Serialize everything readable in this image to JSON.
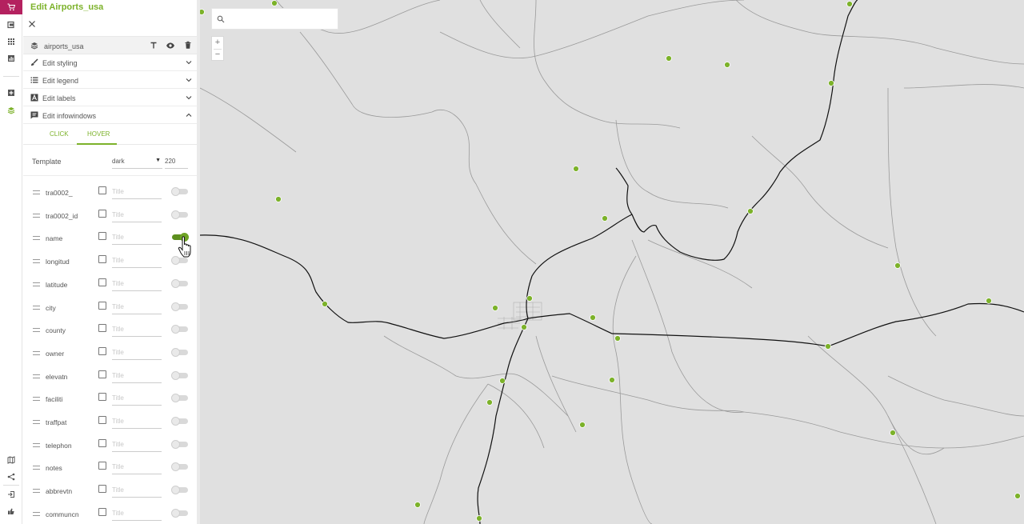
{
  "panel": {
    "title": "Edit Airports_usa",
    "layer_name": "airports_usa",
    "sections": [
      {
        "label": "Edit styling",
        "icon": "brush-icon",
        "chevron": "chevron-down-icon"
      },
      {
        "label": "Edit legend",
        "icon": "list-icon",
        "chevron": "chevron-down-icon"
      },
      {
        "label": "Edit labels",
        "icon": "label-icon",
        "chevron": "chevron-down-icon"
      },
      {
        "label": "Edit infowindows",
        "icon": "infowindow-icon",
        "chevron": "chevron-up-icon"
      }
    ],
    "tabs": [
      {
        "label": "CLICK",
        "active": false
      },
      {
        "label": "HOVER",
        "active": true
      }
    ],
    "template": {
      "label": "Template",
      "value": "dark",
      "width": "220"
    },
    "title_placeholder": "Title",
    "fields": [
      {
        "name": "tra0002_",
        "enabled": false
      },
      {
        "name": "tra0002_id",
        "enabled": false
      },
      {
        "name": "name",
        "enabled": true
      },
      {
        "name": "longitud",
        "enabled": false
      },
      {
        "name": "latitude",
        "enabled": false
      },
      {
        "name": "city",
        "enabled": false
      },
      {
        "name": "county",
        "enabled": false
      },
      {
        "name": "owner",
        "enabled": false
      },
      {
        "name": "elevatn",
        "enabled": false
      },
      {
        "name": "faciliti",
        "enabled": false
      },
      {
        "name": "traffpat",
        "enabled": false
      },
      {
        "name": "telephon",
        "enabled": false
      },
      {
        "name": "notes",
        "enabled": false
      },
      {
        "name": "abbrevtn",
        "enabled": false
      },
      {
        "name": "communcn",
        "enabled": false
      }
    ]
  },
  "map": {
    "search_placeholder": "",
    "zoom_in": "+",
    "zoom_out": "−"
  },
  "colors": {
    "accent": "#7cb22a",
    "brand": "#b4215f",
    "map_background": "#e0e0e0",
    "point": "#7cb22a"
  }
}
